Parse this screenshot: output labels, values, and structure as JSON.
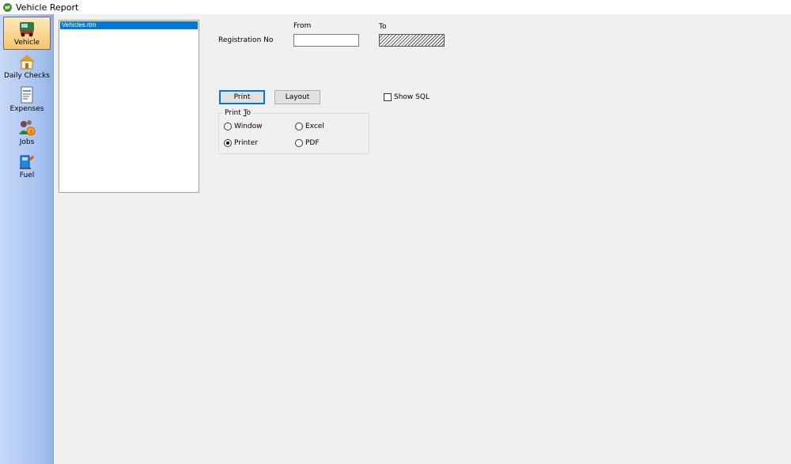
{
  "window": {
    "title": "Vehicle Report"
  },
  "sidebar": {
    "items": [
      {
        "label": "Vehicle",
        "icon": "truck-icon",
        "selected": true
      },
      {
        "label": "Daily Checks",
        "icon": "house-icon",
        "selected": false
      },
      {
        "label": "Expenses",
        "icon": "document-icon",
        "selected": false
      },
      {
        "label": "Jobs",
        "icon": "people-money-icon",
        "selected": false
      },
      {
        "label": "Fuel",
        "icon": "fuel-pump-icon",
        "selected": false
      }
    ]
  },
  "report_list": {
    "items": [
      "Vehicles.rtm"
    ]
  },
  "filters": {
    "from_label": "From",
    "to_label": "To",
    "registration_label": "Registration No",
    "registration_from_value": "",
    "registration_to_value": ""
  },
  "buttons": {
    "print": "Print",
    "layout": "Layout"
  },
  "show_sql": {
    "label": "Show SQL",
    "checked": false
  },
  "print_to": {
    "title": "Print To",
    "title_prefix": "Print ",
    "title_accel": "T",
    "title_suffix": "o",
    "options": [
      {
        "label": "Window",
        "checked": false
      },
      {
        "label": "Excel",
        "checked": false
      },
      {
        "label": "Printer",
        "checked": true
      },
      {
        "label": "PDF",
        "checked": false
      }
    ]
  },
  "colors": {
    "selection": "#0078d7",
    "sidebar": "#a9c3f0",
    "selected_item": "#f8c56c"
  }
}
